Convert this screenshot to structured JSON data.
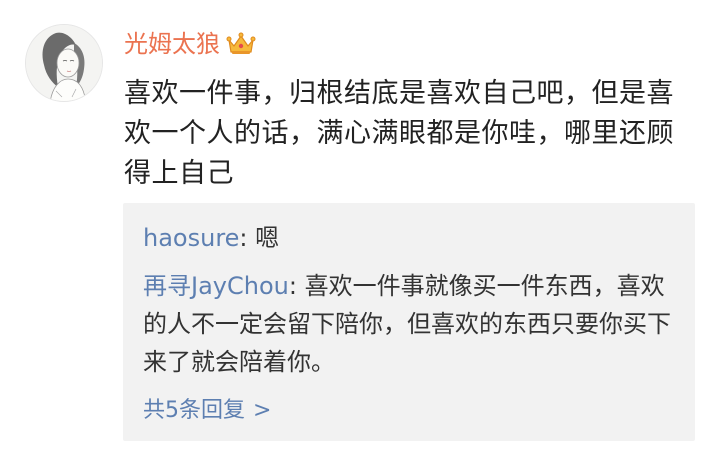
{
  "comment": {
    "username": "光姆太狼",
    "badge_icon": "crown-icon",
    "username_color": "#eb7350",
    "text": "喜欢一件事，归根结底是喜欢自己吧，但是喜欢一个人的话，满心满眼都是你哇，哪里还顾得上自己"
  },
  "replies": {
    "items": [
      {
        "author": "haosure",
        "separator": ": ",
        "text": "嗯"
      },
      {
        "author": "再寻JayChou",
        "separator": ": ",
        "text": "喜欢一件事就像买一件东西，喜欢的人不一定会留下陪你，但喜欢的东西只要你买下来了就会陪着你。"
      }
    ],
    "more_label": "共5条回复",
    "more_chevron": ">",
    "link_color": "#5d7fb1"
  }
}
